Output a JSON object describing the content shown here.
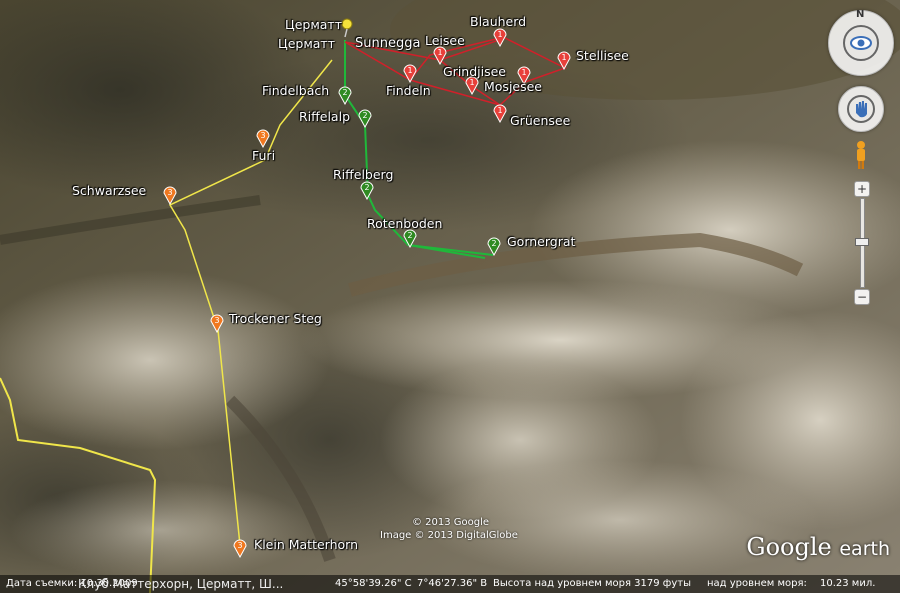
{
  "map": {
    "labels": {
      "zermatt_top": "Церматт",
      "zermatt": "Церматт",
      "sunnegga": "Sunnegga",
      "leisee": "Leisee",
      "blauherd": "Blauherd",
      "stellisee": "Stellisee",
      "grindjisee": "Grindjisee",
      "mosjesee": "Mosjesee",
      "findeln": "Findeln",
      "gruensee": "Grüensee",
      "findelbach": "Findelbach",
      "riffelalp": "Riffelalp",
      "furi": "Furi",
      "schwarzsee": "Schwarzsee",
      "riffelberg": "Riffelberg",
      "rotenboden": "Rotenboden",
      "gornergrat": "Gornergrat",
      "trockener_steg": "Trockener Steg",
      "klein_matterhorn": "Klein Matterhorn"
    },
    "pin_numbers": {
      "red": "1",
      "green": "2",
      "orange": "3"
    },
    "colors": {
      "route_red": "#d0202a",
      "route_green": "#1fb83a",
      "route_yellow": "#f0e64a",
      "pin_red": "#e8403a",
      "pin_green": "#2f8a22",
      "pin_orange": "#f07820"
    }
  },
  "copyright": {
    "line1": "© 2013 Google",
    "line2": "Image © 2013 DigitalGlobe"
  },
  "logo": {
    "google": "Google",
    "earth": "earth"
  },
  "statusbar": {
    "date": "Дата съемки: 10.30.2009",
    "title": "Клуб Маттерхорн, Церматт, Ш...",
    "lat": "45°58'39.26\" С",
    "lon": "7°46'27.36\" В",
    "elevation": "Высота над уровнем моря 3179 футы",
    "eye_alt_label": "над уровнем моря:",
    "eye_alt": "10.23 мил."
  },
  "nav": {
    "north": "N",
    "zoom_in": "+",
    "zoom_out": "−"
  }
}
